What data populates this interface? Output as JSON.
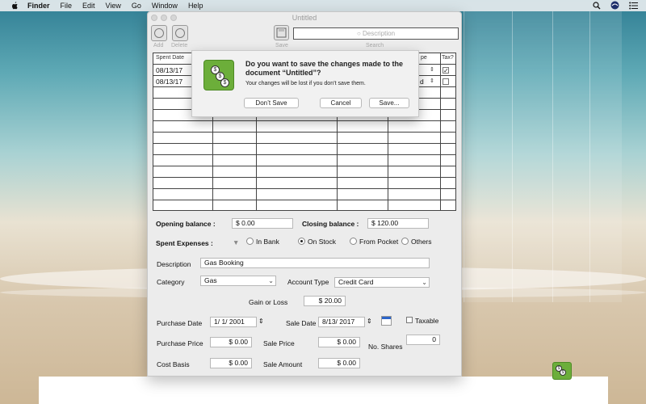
{
  "menubar": {
    "app_name": "Finder",
    "items": [
      "File",
      "Edit",
      "View",
      "Go",
      "Window",
      "Help"
    ]
  },
  "window": {
    "title": "Untitled",
    "toolbar": {
      "add_label": "Add",
      "delete_label": "Delete",
      "save_label": "Save",
      "search_placeholder": "Description",
      "search_label": "Search"
    }
  },
  "table": {
    "headers": {
      "spent_date": "Spent Date",
      "type_partial": "pe",
      "tax": "Tax?"
    },
    "rows": [
      {
        "date": "08/13/17",
        "type_tail": "",
        "tax": true
      },
      {
        "date": "08/13/17",
        "type_tail": "d",
        "tax": false
      }
    ]
  },
  "dialog": {
    "title": "Do you want to save the changes made to the document “Untitled”?",
    "message": "Your changes will be lost if you don’t save them.",
    "dont_save_label": "Don’t Save",
    "cancel_label": "Cancel",
    "save_label": "Save..."
  },
  "form": {
    "opening_balance_label": "Opening balance :",
    "opening_balance_value": "$ 0.00",
    "closing_balance_label": "Closing balance :",
    "closing_balance_value": "$ 120.00",
    "spent_expenses_label": "Spent Expenses  :",
    "radio_options": [
      "In Bank",
      "On Stock",
      "From Pocket",
      "Others"
    ],
    "radio_selected": "On Stock",
    "description_label": "Description",
    "description_value": "Gas Booking",
    "category_label": "Category",
    "category_value": "Gas",
    "account_type_label": "Account Type",
    "account_type_value": "Credit Card",
    "gain_loss_label": "Gain or Loss",
    "gain_loss_value": "$ 20.00",
    "purchase_date_label": "Purchase Date",
    "purchase_date_value": "1/  1/ 2001",
    "sale_date_label": "Sale Date",
    "sale_date_value": "8/13/ 2017",
    "taxable_label": "Taxable",
    "purchase_price_label": "Purchase Price",
    "purchase_price_value": "$ 0.00",
    "sale_price_label": "Sale Price",
    "sale_price_value": "$ 0.00",
    "no_shares_label": "No. Shares",
    "no_shares_value": "0",
    "cost_basis_label": "Cost Basis",
    "cost_basis_value": "$ 0.00",
    "sale_amount_label": "Sale Amount",
    "sale_amount_value": "$ 0.00"
  }
}
